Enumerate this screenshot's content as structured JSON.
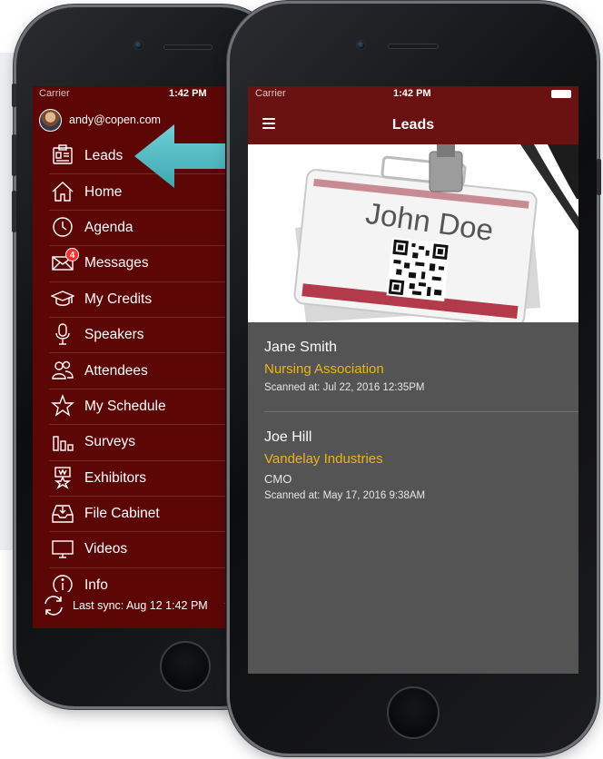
{
  "status": {
    "carrier": "Carrier",
    "time": "1:42 PM"
  },
  "menu_screen": {
    "user_email": "andy@copen.com",
    "items": [
      {
        "label": "Leads",
        "icon": "leads-icon"
      },
      {
        "label": "Home",
        "icon": "home-icon"
      },
      {
        "label": "Agenda",
        "icon": "clock-icon"
      },
      {
        "label": "Messages",
        "icon": "envelope-icon",
        "badge": "4"
      },
      {
        "label": "My Credits",
        "icon": "graduation-cap-icon"
      },
      {
        "label": "Speakers",
        "icon": "microphone-icon"
      },
      {
        "label": "Attendees",
        "icon": "people-icon"
      },
      {
        "label": "My Schedule",
        "icon": "star-icon"
      },
      {
        "label": "Surveys",
        "icon": "bar-chart-icon"
      },
      {
        "label": "Exhibitors",
        "icon": "exhibitor-icon"
      },
      {
        "label": "File Cabinet",
        "icon": "inbox-tray-icon"
      },
      {
        "label": "Videos",
        "icon": "monitor-icon"
      },
      {
        "label": "Info",
        "icon": "info-icon"
      }
    ],
    "sync_text": "Last sync:  Aug 12 1:42 PM"
  },
  "leads_screen": {
    "title": "Leads",
    "badge_image_text": "John Doe",
    "leads": [
      {
        "name": "Jane Smith",
        "organization": "Nursing Association",
        "title": "",
        "scanned": "Scanned at: Jul 22, 2016 12:35PM"
      },
      {
        "name": "Joe Hill",
        "organization": "Vandelay Industries",
        "title": "CMO",
        "scanned": "Scanned at: May 17, 2016 9:38AM"
      }
    ]
  },
  "colors": {
    "menu_bg": "#5d0606",
    "nav_bg": "#6a1212",
    "content_bg": "#545454",
    "org_accent": "#f0b410",
    "arrow": "#5bbec6",
    "badge": "#ff2a2a"
  }
}
